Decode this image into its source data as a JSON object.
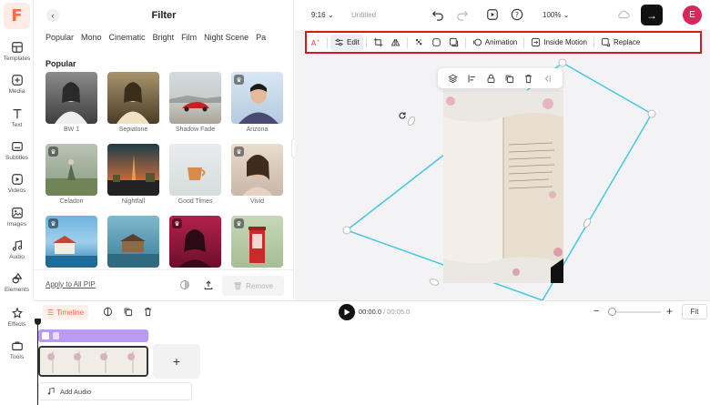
{
  "app": {
    "logo_letter": "F",
    "accent": "#ff6a3d"
  },
  "rail": [
    {
      "label": "Templates",
      "icon": "templates-icon"
    },
    {
      "label": "Media",
      "icon": "media-icon"
    },
    {
      "label": "Text",
      "icon": "text-icon"
    },
    {
      "label": "Subtitles",
      "icon": "subtitles-icon"
    },
    {
      "label": "Videos",
      "icon": "videos-icon"
    },
    {
      "label": "Images",
      "icon": "images-icon"
    },
    {
      "label": "Audio",
      "icon": "audio-icon"
    },
    {
      "label": "Elements",
      "icon": "elements-icon"
    },
    {
      "label": "Effects",
      "icon": "effects-icon"
    },
    {
      "label": "Tools",
      "icon": "tools-icon"
    }
  ],
  "panel": {
    "title": "Filter",
    "tabs": [
      "Popular",
      "Mono",
      "Cinematic",
      "Bright",
      "Film",
      "Night Scene",
      "Pa"
    ],
    "section": "Popular",
    "filters": [
      {
        "name": "BW 1",
        "premium": false
      },
      {
        "name": "Sepiatone",
        "premium": false
      },
      {
        "name": "Shadow Fade",
        "premium": false
      },
      {
        "name": "Arizona",
        "premium": true
      },
      {
        "name": "Celadon",
        "premium": true
      },
      {
        "name": "Nightfall",
        "premium": false
      },
      {
        "name": "Good Times",
        "premium": false
      },
      {
        "name": "Vivid",
        "premium": true
      },
      {
        "name": "",
        "premium": true
      },
      {
        "name": "",
        "premium": false
      },
      {
        "name": "",
        "premium": true
      },
      {
        "name": "",
        "premium": true
      }
    ],
    "apply_all": "Apply to All PIP",
    "remove": "Remove"
  },
  "topbar": {
    "ratio": "9:16",
    "doc_title": "Untitled",
    "zoom": "100%",
    "avatar_letter": "E",
    "avatar_color": "#d6265a"
  },
  "toolbar": {
    "edit": "Edit",
    "animation": "Animation",
    "inside_motion": "Inside Motion",
    "replace": "Replace",
    "highlight_color": "#d11a1a"
  },
  "timeline": {
    "label": "Timeline",
    "current": "00:00.0",
    "total": "/ 00:05.0",
    "fit": "Fit",
    "add_audio": "Add Audio",
    "pip_color": "#b99af5",
    "clip_frames": 4
  }
}
